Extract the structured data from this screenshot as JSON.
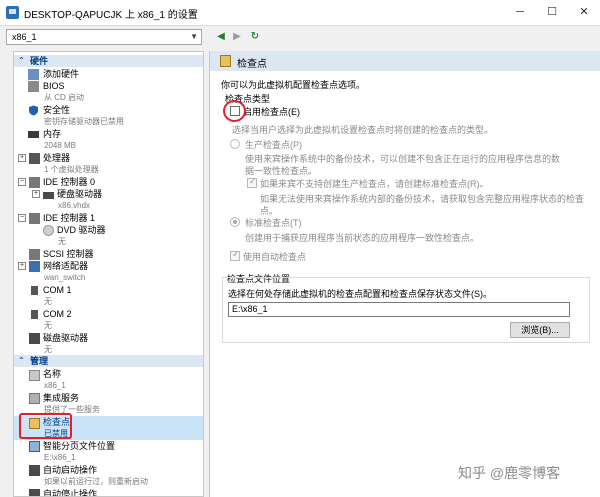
{
  "window": {
    "title": "DESKTOP-QAPUCJK 上 x86_1 的设置",
    "minimize": "─",
    "maximize": "☐",
    "close": "✕"
  },
  "toolbar": {
    "vm_selected": "x86_1",
    "back_icon": "◀",
    "forward_icon": "▶",
    "refresh_icon": "↻"
  },
  "sidebar": {
    "hardware_header": "硬件",
    "management_header": "管理",
    "items": [
      {
        "label": "添加硬件",
        "sub": ""
      },
      {
        "label": "BIOS",
        "sub": "从 CD 启动"
      },
      {
        "label": "安全性",
        "sub": "密钥存储驱动器已禁用"
      },
      {
        "label": "内存",
        "sub": "2048 MB"
      },
      {
        "label": "处理器",
        "sub": "1 个虚拟处理器"
      },
      {
        "label": "IDE 控制器 0",
        "sub": ""
      },
      {
        "label": "硬盘驱动器",
        "sub": "x86.vhdx"
      },
      {
        "label": "IDE 控制器 1",
        "sub": ""
      },
      {
        "label": "DVD 驱动器",
        "sub": "无"
      },
      {
        "label": "SCSI 控制器",
        "sub": ""
      },
      {
        "label": "网络适配器",
        "sub": "wan_switch"
      },
      {
        "label": "COM 1",
        "sub": "无"
      },
      {
        "label": "COM 2",
        "sub": "无"
      },
      {
        "label": "磁盘驱动器",
        "sub": "无"
      }
    ],
    "mgmt_items": [
      {
        "label": "名称",
        "sub": "x86_1"
      },
      {
        "label": "集成服务",
        "sub": "提供了一些服务"
      },
      {
        "label": "检查点",
        "sub": "已禁用"
      },
      {
        "label": "智能分页文件位置",
        "sub": "E:\\x86_1"
      },
      {
        "label": "自动启动操作",
        "sub": "如果以前运行过，则重新启动"
      },
      {
        "label": "自动停止操作",
        "sub": ""
      }
    ]
  },
  "panel": {
    "title": "检查点",
    "intro": "你可以为此虚拟机配置检查点选项。",
    "type_label": "检查点类型",
    "enable_label": "启用检查点(E)",
    "choose_desc": "选择当用户选择为此虚拟机设置检查点时将创建的检查点的类型。",
    "production_label": "生产检查点(P)",
    "production_desc_1": "使用来宾操作系统中的备份技术，可以创建不包含正在运行的应用程序信息的数",
    "production_desc_2": "据一致性检查点。",
    "fallback_label": "如果来宾不支持创建生产检查点，请创建标准检查点(R)。",
    "fallback_desc_1": "如果无法使用来宾操作系统内部的备份技术，请获取包含完整应用程序状态的检查",
    "fallback_desc_2": "点。",
    "standard_label": "标准检查点(T)",
    "standard_desc": "创建用于捕获应用程序当前状态的应用程序一致性检查点。",
    "auto_label": "使用自动检查点",
    "location_label": "检查点文件位置",
    "location_desc": "选择在何处存储此虚拟机的检查点配置和检查点保存状态文件(S)。",
    "location_value": "E:\\x86_1",
    "browse_label": "浏览(B)..."
  },
  "watermark": "知乎 @鹿零博客",
  "colors": {
    "header_bg": "#dce7f3",
    "selection_bg": "#cce4f7",
    "highlight_red": "#e0202a",
    "section_text": "#003d8c"
  }
}
